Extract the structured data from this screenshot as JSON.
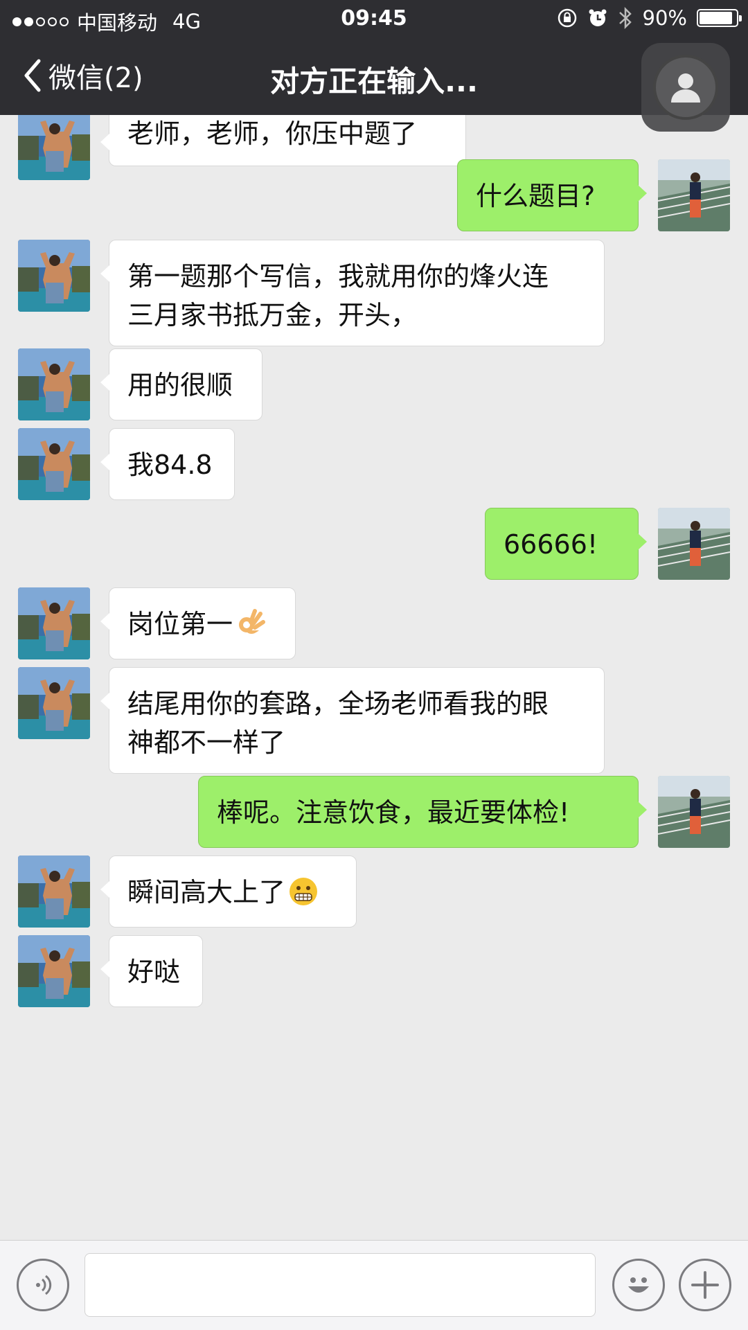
{
  "status_bar": {
    "carrier": "中国移动",
    "network": "4G",
    "time": "09:45",
    "battery_percent_label": "90%",
    "battery_level": 0.9,
    "signal_bars_filled": 2,
    "signal_bars_total": 5
  },
  "nav": {
    "back_label": "微信(2)",
    "title": "对方正在输入..."
  },
  "messages": [
    {
      "side": "in",
      "text": "老师，老师，你压中题了"
    },
    {
      "side": "out",
      "text": "什么题目?"
    },
    {
      "side": "in",
      "text": "第一题那个写信，我就用你的烽火连\n三月家书抵万金，开头，"
    },
    {
      "side": "in",
      "text": "用的很顺"
    },
    {
      "side": "in",
      "text": "我84.8"
    },
    {
      "side": "out",
      "text": "66666!"
    },
    {
      "side": "in",
      "text": "岗位第一",
      "emoji": "ok-hand-emoji"
    },
    {
      "side": "in",
      "text": "结尾用你的套路，全场老师看我的眼\n神都不一样了"
    },
    {
      "side": "out",
      "text": "棒呢。注意饮食，最近要体检!"
    },
    {
      "side": "in",
      "text": "瞬间高大上了",
      "emoji": "grin-emoji"
    },
    {
      "side": "in",
      "text": "好哒"
    }
  ],
  "input_bar": {
    "voice_icon": "voice-icon",
    "emoji_icon": "smile-icon",
    "plus_icon": "plus-icon",
    "text_value": ""
  },
  "colors": {
    "nav_bg": "#2e2e32",
    "chat_bg": "#ebebeb",
    "incoming_bubble": "#ffffff",
    "outgoing_bubble": "#9def6a"
  }
}
